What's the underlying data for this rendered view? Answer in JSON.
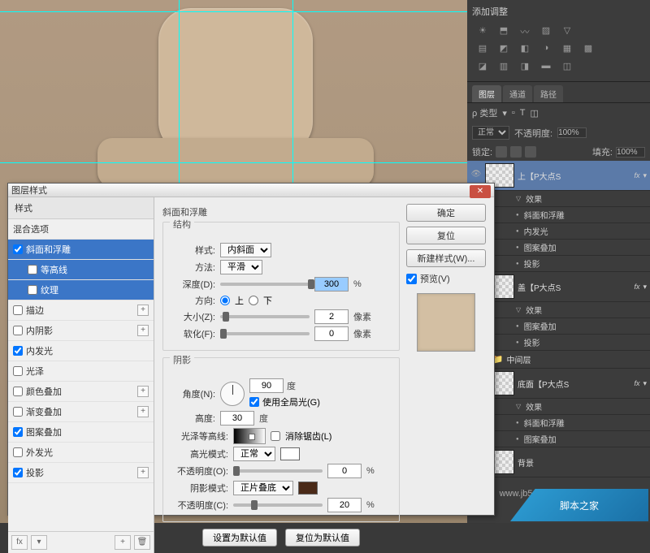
{
  "adjustments": {
    "title": "添加调整"
  },
  "layersPanel": {
    "tabs": [
      "图层",
      "通道",
      "路径"
    ],
    "kindLabel": "ρ 类型",
    "blend": "正常",
    "opacityLabel": "不透明度:",
    "opacityVal": "100%",
    "lockLabel": "锁定:",
    "fillLabel": "填充:",
    "fillVal": "100%"
  },
  "layers": [
    {
      "name": "上【P大点S",
      "fx": "fx",
      "selected": true,
      "subs": [
        "效果",
        "斜面和浮雕",
        "内发光",
        "图案叠加",
        "投影"
      ]
    },
    {
      "name": "盖【P大点S",
      "fx": "fx",
      "subs": [
        "效果",
        "图案叠加",
        "投影"
      ]
    },
    {
      "name": "中间层",
      "isGroup": true
    },
    {
      "name": "底面【P大点S",
      "fx": "fx",
      "subs": [
        "效果",
        "斜面和浮雕",
        "图案叠加"
      ]
    },
    {
      "name": "背景"
    }
  ],
  "dialog": {
    "title": "图层样式",
    "stylesHead": "样式",
    "blendOpts": "混合选项",
    "list": [
      {
        "label": "斜面和浮雕",
        "checked": true,
        "selected": true,
        "plus": false
      },
      {
        "label": "等高线",
        "checked": false,
        "sub": true,
        "selected": true
      },
      {
        "label": "纹理",
        "checked": false,
        "sub": true,
        "selected": true
      },
      {
        "label": "描边",
        "checked": false,
        "plus": true
      },
      {
        "label": "内阴影",
        "checked": false,
        "plus": true
      },
      {
        "label": "内发光",
        "checked": true
      },
      {
        "label": "光泽",
        "checked": false
      },
      {
        "label": "颜色叠加",
        "checked": false,
        "plus": true
      },
      {
        "label": "渐变叠加",
        "checked": false,
        "plus": true
      },
      {
        "label": "图案叠加",
        "checked": true
      },
      {
        "label": "外发光",
        "checked": false
      },
      {
        "label": "投影",
        "checked": true,
        "plus": true
      }
    ],
    "buttons": {
      "ok": "确定",
      "cancel": "复位",
      "new": "新建样式(W)...",
      "preview": "预览(V)",
      "default1": "设置为默认值",
      "default2": "复位为默认值"
    },
    "section": {
      "title": "斜面和浮雕",
      "group1": "结构",
      "styleLbl": "样式:",
      "styleVal": "内斜面",
      "techLbl": "方法:",
      "techVal": "平滑",
      "depthLbl": "深度(D):",
      "depthVal": "300",
      "depthUnit": "%",
      "dirLbl": "方向:",
      "dirUp": "上",
      "dirDown": "下",
      "sizeLbl": "大小(Z):",
      "sizeVal": "2",
      "sizeUnit": "像素",
      "softLbl": "软化(F):",
      "softVal": "0",
      "softUnit": "像素",
      "group2": "阴影",
      "angleLbl": "角度(N):",
      "angleVal": "90",
      "angleUnit": "度",
      "globalLbl": "使用全局光(G)",
      "altLbl": "高度:",
      "altVal": "30",
      "altUnit": "度",
      "glossLbl": "光泽等高线:",
      "antiLbl": "消除锯齿(L)",
      "hiLbl": "高光模式:",
      "hiVal": "正常",
      "hiOpLbl": "不透明度(O):",
      "hiOpVal": "0",
      "hiOpUnit": "%",
      "shLbl": "阴影模式:",
      "shVal": "正片叠底",
      "shOpLbl": "不透明度(C):",
      "shOpVal": "20",
      "shOpUnit": "%",
      "shColor": "#4a2a18"
    }
  },
  "watermark": {
    "site": "www.jb51.net",
    "brand": "脚本之家"
  }
}
